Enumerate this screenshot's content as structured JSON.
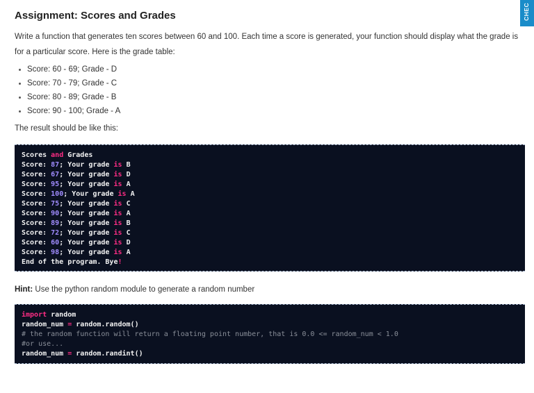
{
  "title": "Assignment: Scores and Grades",
  "intro": "Write a function that generates ten scores between 60 and 100. Each time a score is generated, your function should display what the grade is for a particular score. Here is the grade table:",
  "grade_table": [
    "Score: 60 - 69; Grade - D",
    "Score: 70 - 79; Grade - C",
    "Score: 80 - 89; Grade - B",
    "Score: 90 - 100; Grade - A"
  ],
  "result_label": "The result should be like this:",
  "output": {
    "header": [
      "Scores",
      "and",
      "Grades"
    ],
    "rows": [
      {
        "score": "87",
        "grade": "B"
      },
      {
        "score": "67",
        "grade": "D"
      },
      {
        "score": "95",
        "grade": "A"
      },
      {
        "score": "100",
        "grade": "A"
      },
      {
        "score": "75",
        "grade": "C"
      },
      {
        "score": "90",
        "grade": "A"
      },
      {
        "score": "89",
        "grade": "B"
      },
      {
        "score": "72",
        "grade": "C"
      },
      {
        "score": "60",
        "grade": "D"
      },
      {
        "score": "98",
        "grade": "A"
      }
    ],
    "row_prefix": "Score: ",
    "row_mid": "; Your grade ",
    "row_kw": "is",
    "footer": "End of the program. Bye",
    "footer_bang": "!"
  },
  "hint": {
    "label": "Hint:",
    "text": " Use the python random module to generate a random number"
  },
  "snippet": {
    "import_kw": "import",
    "import_mod": " random",
    "line2_var": "random_num ",
    "line2_op": "=",
    "line2_val": " random.random()",
    "comment1": "# the random function will return a floating point number, that is 0.0 <= random_num < 1.0",
    "comment2": "#or use...",
    "line5_var": "random_num ",
    "line5_op": "=",
    "line5_val": " random.randint()"
  },
  "check_tab": "CHEC",
  "colors": {
    "keyword": "#ff2d85",
    "number": "#a08cff",
    "code_bg": "#0a1020",
    "tab": "#1a8cc9"
  }
}
